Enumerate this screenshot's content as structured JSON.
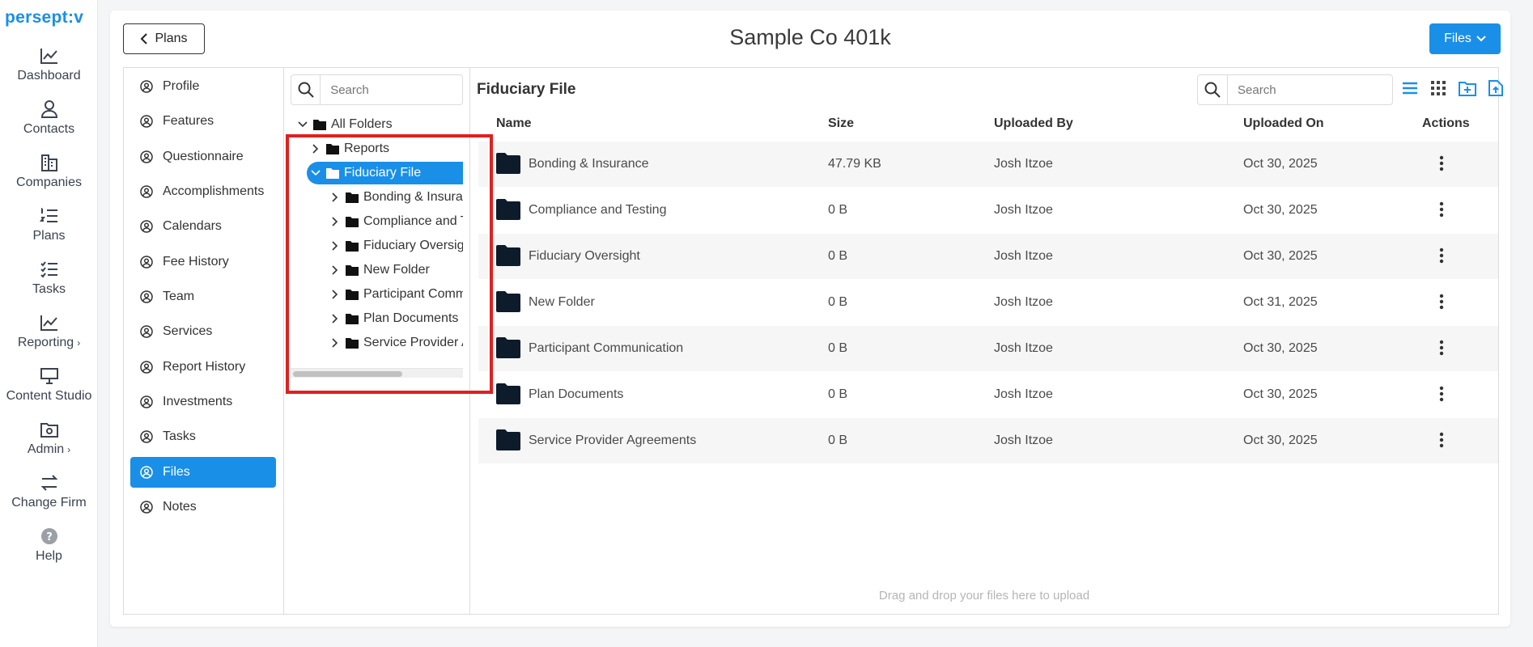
{
  "app": {
    "logo": "persept:v"
  },
  "appnav": [
    {
      "label": "Dashboard",
      "icon": "chart-line-icon"
    },
    {
      "label": "Contacts",
      "icon": "user-icon"
    },
    {
      "label": "Companies",
      "icon": "building-icon"
    },
    {
      "label": "Plans",
      "icon": "list-ordered-icon"
    },
    {
      "label": "Tasks",
      "icon": "checklist-icon"
    },
    {
      "label": "Reporting",
      "icon": "chart-line-icon",
      "chevron": "›"
    },
    {
      "label": "Content Studio",
      "icon": "presentation-icon"
    },
    {
      "label": "Admin",
      "icon": "folder-gear-icon",
      "chevron": "›"
    },
    {
      "label": "Change Firm",
      "icon": "swap-icon"
    },
    {
      "label": "Help",
      "icon": "help-icon"
    }
  ],
  "header": {
    "back_label": "Plans",
    "title": "Sample Co 401k",
    "files_label": "Files"
  },
  "sections": [
    "Profile",
    "Features",
    "Questionnaire",
    "Accomplishments",
    "Calendars",
    "Fee History",
    "Team",
    "Services",
    "Report History",
    "Investments",
    "Tasks",
    "Files",
    "Notes"
  ],
  "active_section": "Files",
  "tree": {
    "search_placeholder": "Search",
    "root": "All Folders",
    "nodes": [
      {
        "label": "Reports",
        "level": 1
      },
      {
        "label": "Fiduciary File",
        "level": 1,
        "selected": true,
        "expanded": true
      },
      {
        "label": "Bonding & Insurance",
        "level": 2
      },
      {
        "label": "Compliance and Testing",
        "level": 2
      },
      {
        "label": "Fiduciary Oversight",
        "level": 2
      },
      {
        "label": "New Folder",
        "level": 2
      },
      {
        "label": "Participant Communication",
        "level": 2
      },
      {
        "label": "Plan Documents",
        "level": 2
      },
      {
        "label": "Service Provider Agreements",
        "level": 2
      }
    ]
  },
  "grid": {
    "title": "Fiduciary File",
    "search_placeholder": "Search",
    "columns": {
      "name": "Name",
      "size": "Size",
      "uploaded_by": "Uploaded By",
      "uploaded_on": "Uploaded On",
      "actions": "Actions"
    },
    "rows": [
      {
        "name": "Bonding & Insurance",
        "size": "47.79 KB",
        "uploaded_by": "Josh Itzoe",
        "uploaded_on": "Oct 30, 2025"
      },
      {
        "name": "Compliance and Testing",
        "size": "0 B",
        "uploaded_by": "Josh Itzoe",
        "uploaded_on": "Oct 30, 2025"
      },
      {
        "name": "Fiduciary Oversight",
        "size": "0 B",
        "uploaded_by": "Josh Itzoe",
        "uploaded_on": "Oct 30, 2025"
      },
      {
        "name": "New Folder",
        "size": "0 B",
        "uploaded_by": "Josh Itzoe",
        "uploaded_on": "Oct 31, 2025"
      },
      {
        "name": "Participant Communication",
        "size": "0 B",
        "uploaded_by": "Josh Itzoe",
        "uploaded_on": "Oct 30, 2025"
      },
      {
        "name": "Plan Documents",
        "size": "0 B",
        "uploaded_by": "Josh Itzoe",
        "uploaded_on": "Oct 30, 2025"
      },
      {
        "name": "Service Provider Agreements",
        "size": "0 B",
        "uploaded_by": "Josh Itzoe",
        "uploaded_on": "Oct 30, 2025"
      }
    ],
    "dropzone_text": "Drag and drop your files here to upload"
  },
  "colors": {
    "accent": "#1a8fe8",
    "highlight": "#e02020",
    "folder": "#0d1b2a"
  }
}
